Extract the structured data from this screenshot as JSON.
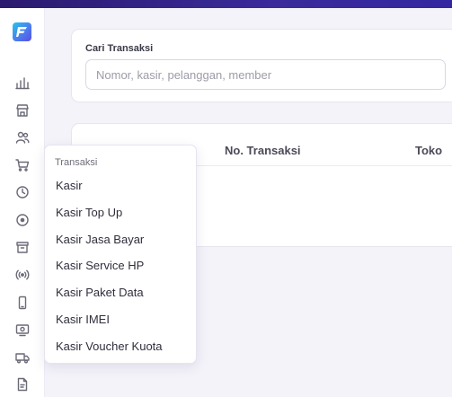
{
  "search": {
    "label": "Cari Transaksi",
    "placeholder": "Nomor, kasir, pelanggan, member",
    "value": ""
  },
  "table": {
    "columns": [
      "No. Transaksi",
      "Toko"
    ]
  },
  "menu": {
    "title": "Transaksi",
    "items": [
      "Kasir",
      "Kasir Top Up",
      "Kasir Jasa Bayar",
      "Kasir Service HP",
      "Kasir Paket Data",
      "Kasir IMEI",
      "Kasir Voucher Kuota"
    ]
  },
  "sidebar": {
    "icons": [
      "bar-chart-icon",
      "store-icon",
      "users-icon",
      "cart-icon",
      "clock-icon",
      "circle-dot-icon",
      "archive-icon",
      "broadcast-icon",
      "smartphone-icon",
      "monitor-icon",
      "truck-icon",
      "file-icon"
    ]
  },
  "colors": {
    "topbar": "#2b1a6e",
    "accent": "#4a7df0",
    "background": "#f4f3fa"
  }
}
